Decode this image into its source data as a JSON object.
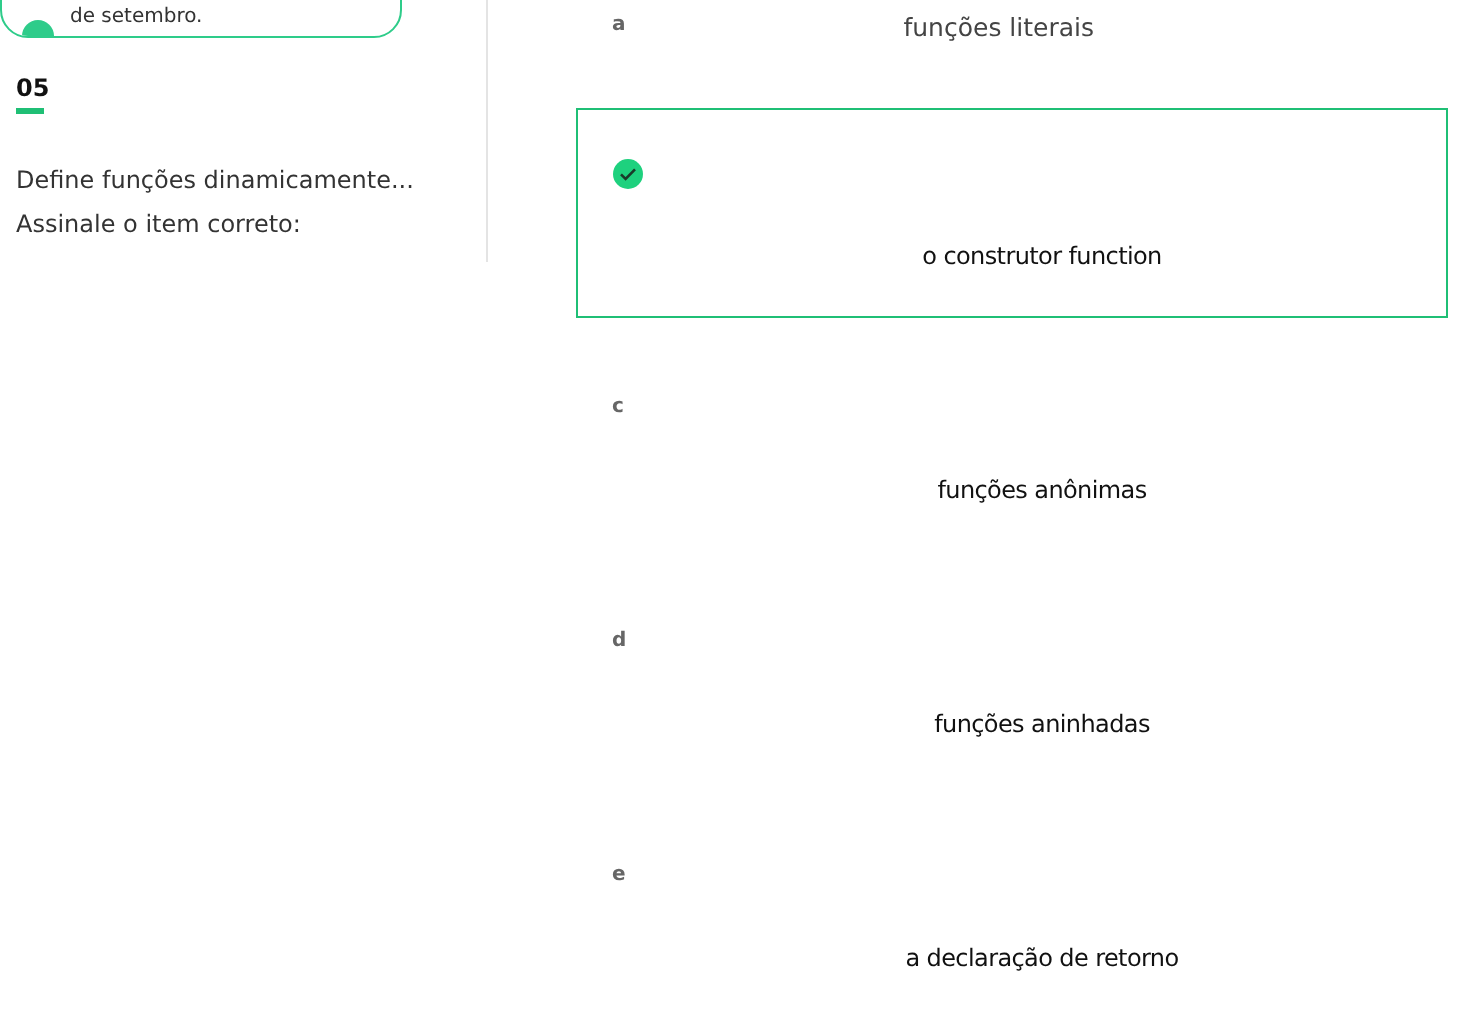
{
  "date_badge": {
    "text": "de setembro."
  },
  "question": {
    "number": "05",
    "text": "Define funções dinamicamente...",
    "prompt": "Assinale o item correto:"
  },
  "options": [
    {
      "kind": "inline",
      "letter": "a",
      "text": "funções literais",
      "selected": false
    },
    {
      "kind": "stacked",
      "text": "o construtor function",
      "selected": true
    },
    {
      "kind": "stacked",
      "letter": "c",
      "text": "funções anônimas",
      "selected": false
    },
    {
      "kind": "stacked",
      "letter": "d",
      "text": "funções aninhadas",
      "selected": false
    },
    {
      "kind": "stacked",
      "letter": "e",
      "text": "a declaração de retorno",
      "selected": false
    }
  ]
}
